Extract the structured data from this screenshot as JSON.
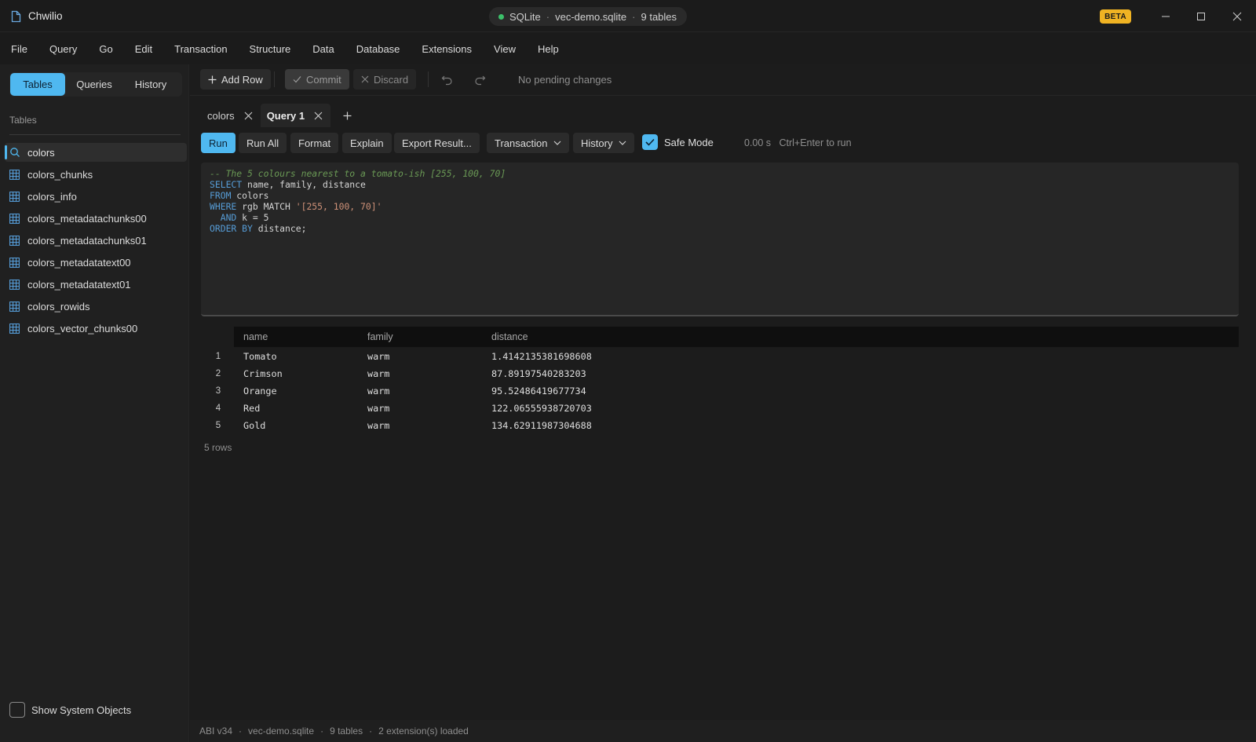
{
  "window": {
    "app_name": "Chwilio",
    "connection": {
      "engine": "SQLite",
      "database": "vec-demo.sqlite",
      "tables": "9 tables",
      "separator": "·",
      "status_color": "#3cc06a"
    },
    "beta_badge": "BETA"
  },
  "menu": [
    "File",
    "Query",
    "Go",
    "Edit",
    "Transaction",
    "Structure",
    "Data",
    "Database",
    "Extensions",
    "View",
    "Help"
  ],
  "sidebar": {
    "tabs": [
      "Tables",
      "Queries",
      "History"
    ],
    "active_tab": "Tables",
    "section_title": "Tables",
    "search_value": "colors",
    "tables": [
      "colors_chunks",
      "colors_info",
      "colors_metadatachunks00",
      "colors_metadatachunks01",
      "colors_metadatatext00",
      "colors_metadatatext01",
      "colors_rowids",
      "colors_vector_chunks00"
    ],
    "show_system_objects": "Show System Objects"
  },
  "toolbar": {
    "add_row": "Add Row",
    "commit": "Commit",
    "discard": "Discard",
    "pending": "No pending changes"
  },
  "doc_tabs": [
    {
      "label": "colors",
      "active": false
    },
    {
      "label": "Query 1",
      "active": true
    }
  ],
  "query_bar": {
    "run": "Run",
    "run_all": "Run All",
    "format": "Format",
    "explain": "Explain",
    "export": "Export Result...",
    "transaction": "Transaction",
    "history": "History",
    "safe_mode": "Safe Mode",
    "safe_mode_checked": true,
    "elapsed": "0.00 s",
    "hint": "Ctrl+Enter to run"
  },
  "editor": {
    "lines": [
      "-- The 5 colours nearest to a tomato-ish [255, 100, 70]",
      "SELECT name, family, distance",
      "FROM colors",
      "WHERE rgb MATCH '[255, 100, 70]'",
      "  AND k = 5",
      "ORDER BY distance;"
    ]
  },
  "results": {
    "columns": [
      "name",
      "family",
      "distance"
    ],
    "rows": [
      {
        "n": "1",
        "name": "Tomato",
        "family": "warm",
        "distance": "1.4142135381698608"
      },
      {
        "n": "2",
        "name": "Crimson",
        "family": "warm",
        "distance": "87.89197540283203"
      },
      {
        "n": "3",
        "name": "Orange",
        "family": "warm",
        "distance": "95.52486419677734"
      },
      {
        "n": "4",
        "name": "Red",
        "family": "warm",
        "distance": "122.06555938720703"
      },
      {
        "n": "5",
        "name": "Gold",
        "family": "warm",
        "distance": "134.62911987304688"
      }
    ],
    "row_count": "5 rows"
  },
  "statusbar": [
    "ABI v34",
    "vec-demo.sqlite",
    "9 tables",
    "2 extension(s) loaded"
  ],
  "colors": {
    "accent": "#4fb8f0",
    "beta": "#f0b323"
  }
}
